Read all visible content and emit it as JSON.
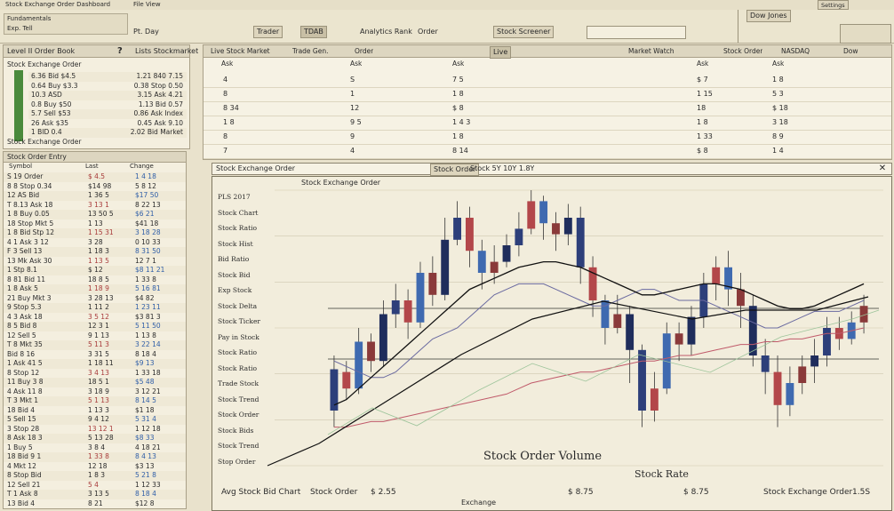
{
  "menubar": {
    "title_left": "Stock Exchange Order Dashboard",
    "title_mid": "File View",
    "btn_right": "Settings"
  },
  "toolbar": {
    "items": [
      "Fundamentals",
      "Exp. Tell",
      "Pt. Day",
      "Trader",
      "TDAB",
      "Analytics Rank",
      "Order",
      "Stock Screener"
    ],
    "right_label": "Dow Jones"
  },
  "left_top": {
    "title": "Level II Order Book",
    "question": "?",
    "tab": "Lists Stockmarket",
    "sub": "Stock Exchange Order",
    "rows": [
      {
        "a": "6.36 Bid $4.5",
        "b": "1.21 840 7.15"
      },
      {
        "a": "0.64 Buy $3.3",
        "b": "0.38 Stop 0.50"
      },
      {
        "a": "10.3 ASD",
        "b": "3.15 Ask 4.21"
      },
      {
        "a": "0.8 Buy $50",
        "b": "1.13 Bid 0.57"
      },
      {
        "a": "5.7 Sell $53",
        "b": "0.86 Ask Index"
      },
      {
        "a": "26 Ask $35",
        "b": "0.45 Ask 9.10"
      },
      {
        "a": "1 BID 0.4",
        "b": "2.02 Bid Market"
      }
    ],
    "footer": "Stock Exchange Order"
  },
  "watchlist": {
    "title": "Stock Order Entry",
    "columns": [
      "Symbol",
      "Last",
      "Change"
    ],
    "rows": [
      [
        "S 19 Order",
        "$ 4.5",
        "1 4 18"
      ],
      [
        "8 8 Stop 0.34",
        "$14 98",
        "5 8 12"
      ],
      [
        "12 AS Bid",
        "1 36 5",
        "$17 50"
      ],
      [
        "T 8.13 Ask 18",
        "3 13 1",
        "8 22 13"
      ],
      [
        "1 8 Buy 0.05",
        "13 50 5",
        "$6 21"
      ],
      [
        "18 Stop Mkt 5",
        "1 13",
        "$41 18"
      ],
      [
        "1 8 Bid Stp 12",
        "1 15 31",
        "3 18 28"
      ],
      [
        "4 1 Ask 3 12",
        "3 28",
        "0 10 33"
      ],
      [
        "F 3 Sell 13",
        "1 18 3",
        "8 31 50"
      ],
      [
        "13 Mk Ask 30",
        "1 13 5",
        "12 7 1"
      ],
      [
        "1 Stp 8.1",
        "$ 12",
        "$8 11 21"
      ],
      [
        "8 81 Bid 11",
        "18 8 5",
        "1 33 8"
      ],
      [
        "1 8 Ask 5",
        "1 18 9",
        "5 16 81"
      ],
      [
        "21 Buy Mkt 3",
        "3 28 13",
        "$4 82"
      ],
      [
        "9 Stop 5.3",
        "1 11 2",
        "1 23 11"
      ],
      [
        "4 3 Ask 18",
        "3 5 12",
        "$3 81 3"
      ],
      [
        "8 5 Bid 8",
        "12 3 1",
        "5 11 50"
      ],
      [
        "12 Sell 5",
        "9 1 13",
        "1 13 8"
      ],
      [
        "T 8 Mkt 35",
        "5 11 3",
        "3 22 14"
      ],
      [
        "Bid 8 16",
        "3 31 5",
        "8 18 4"
      ],
      [
        "1 Ask 41 5",
        "1 18 11",
        "$9 13"
      ],
      [
        "8 Stop 12",
        "3 4 13",
        "1 33 18"
      ],
      [
        "11 Buy 3 8",
        "18 5 1",
        "$5 48"
      ],
      [
        "4 Ask 11 8",
        "3 18 9",
        "3 12 21"
      ],
      [
        "T 3 Mkt 1",
        "5 1 13",
        "8 14 5"
      ],
      [
        "18 Bid 4",
        "1 13 3",
        "$1 18"
      ],
      [
        "5 Sell 15",
        "9 4 12",
        "5 31 4"
      ],
      [
        "3 Stop 28",
        "13 12 1",
        "1 12 18"
      ],
      [
        "8 Ask 18 3",
        "5 13 28",
        "$8 33"
      ],
      [
        "1 Buy 5",
        "3 8 4",
        "4 18 21"
      ],
      [
        "18 Bid 9 1",
        "1 33 8",
        "8 4 13"
      ],
      [
        "4 Mkt 12",
        "12 18",
        "$3 13"
      ],
      [
        "8 Stop Bid",
        "1 8 3",
        "5 21 8"
      ],
      [
        "12 Sell 21",
        "5 4",
        "1 12 33"
      ],
      [
        "T 1 Ask 8",
        "3 13 5",
        "8 18 4"
      ],
      [
        "13 Bid 4",
        "8 21",
        "$12 8"
      ]
    ]
  },
  "order_grid": {
    "tabs": [
      "Live Stock Market",
      "Trade Gen.",
      "Order"
    ],
    "chip": "Live",
    "right": [
      "Market Watch",
      "Stock Order",
      "NASDAQ",
      "Dow"
    ],
    "columns": [
      "Ask",
      "Ask",
      "Ask",
      "Ask",
      "Ask"
    ],
    "rows": [
      [
        "4",
        "S",
        "7 5",
        "$ 7",
        "1 8"
      ],
      [
        "8",
        "1",
        "1 8",
        "1 15",
        "5 3"
      ],
      [
        "8 34",
        "12",
        "$ 8",
        "18",
        "$ 18"
      ],
      [
        "1 8",
        "9 5",
        "1 4 3",
        "1 8",
        "3 18"
      ],
      [
        "8",
        "9",
        "1 8",
        "1 33",
        "8 9"
      ],
      [
        "7",
        "4",
        "8 14",
        "$ 8",
        "1 4"
      ]
    ]
  },
  "chart_bar": {
    "label_left": "Stock Exchange Order",
    "label_mid": "Stock Order",
    "label_chip": "Stock 5Y 10Y 1.8Y",
    "close_icon": "close-icon"
  },
  "chart": {
    "overlay_title": "Stock Exchange Order",
    "left_labels": [
      "PLS 2017",
      "Stock Chart",
      "Stock Ratio",
      "Stock Hist",
      "Bid Ratio",
      "Stock Bid",
      "Exp Stock",
      "Stock Delta",
      "Stock Ticker",
      "Pay in Stock",
      "Stock Ratio",
      "Stock Ratio",
      "Trade Stock",
      "Stock Trend",
      "Stock Order",
      "Stock Bids",
      "Stock Trend",
      "Stop Order"
    ],
    "annotation_main": "Stock Order Volume",
    "annotation_right": "Stock Rate",
    "bottom_labels": [
      "Avg Stock Bid Chart",
      "Stock Order",
      "$ 2.55",
      "Exchange",
      "$ 8.75",
      "$ 8.75",
      "Stock Exchange Order",
      "1.5S"
    ],
    "status_bottom": "Exchange"
  },
  "chart_data": {
    "type": "candlestick",
    "note": "Visual candlestick chart with moving averages; values approximate in price units",
    "y_range": [
      0,
      100
    ],
    "candles": [
      [
        20,
        35,
        14,
        40
      ],
      [
        34,
        28,
        24,
        38
      ],
      [
        28,
        45,
        26,
        50
      ],
      [
        45,
        38,
        34,
        48
      ],
      [
        38,
        55,
        36,
        60
      ],
      [
        55,
        60,
        50,
        66
      ],
      [
        60,
        52,
        46,
        64
      ],
      [
        52,
        70,
        50,
        74
      ],
      [
        70,
        62,
        58,
        76
      ],
      [
        62,
        82,
        60,
        90
      ],
      [
        82,
        90,
        80,
        96
      ],
      [
        90,
        78,
        72,
        94
      ],
      [
        78,
        70,
        64,
        82
      ],
      [
        70,
        74,
        66,
        80
      ],
      [
        74,
        80,
        72,
        84
      ],
      [
        80,
        86,
        76,
        92
      ],
      [
        86,
        96,
        84,
        100
      ],
      [
        96,
        88,
        82,
        98
      ],
      [
        88,
        84,
        78,
        92
      ],
      [
        84,
        90,
        80,
        95
      ],
      [
        90,
        72,
        66,
        94
      ],
      [
        72,
        60,
        54,
        76
      ],
      [
        60,
        50,
        44,
        62
      ],
      [
        50,
        55,
        48,
        62
      ],
      [
        55,
        42,
        30,
        58
      ],
      [
        42,
        20,
        14,
        44
      ],
      [
        20,
        28,
        16,
        34
      ],
      [
        28,
        48,
        26,
        52
      ],
      [
        48,
        44,
        38,
        52
      ],
      [
        44,
        54,
        40,
        58
      ],
      [
        54,
        66,
        50,
        70
      ],
      [
        66,
        72,
        60,
        76
      ],
      [
        72,
        64,
        58,
        78
      ],
      [
        64,
        58,
        50,
        70
      ],
      [
        58,
        40,
        36,
        62
      ],
      [
        40,
        34,
        26,
        46
      ],
      [
        34,
        22,
        14,
        40
      ],
      [
        22,
        30,
        18,
        36
      ],
      [
        30,
        36,
        26,
        40
      ],
      [
        36,
        40,
        30,
        46
      ],
      [
        40,
        50,
        36,
        54
      ],
      [
        50,
        46,
        42,
        54
      ],
      [
        46,
        52,
        44,
        56
      ],
      [
        52,
        58,
        48,
        62
      ]
    ],
    "moving_average_1": [
      22,
      24,
      28,
      32,
      36,
      40,
      44,
      48,
      52,
      56,
      60,
      64,
      66,
      68,
      70,
      72,
      73,
      74,
      74,
      73,
      72,
      70,
      68,
      66,
      64,
      62,
      62,
      63,
      64,
      65,
      66,
      66,
      65,
      64,
      62,
      60,
      58,
      57,
      57,
      58,
      60,
      62,
      64,
      66
    ],
    "moving_average_2": [
      38,
      36,
      34,
      32,
      32,
      34,
      38,
      42,
      46,
      48,
      50,
      54,
      58,
      62,
      64,
      66,
      66,
      66,
      64,
      62,
      60,
      58,
      58,
      60,
      62,
      64,
      64,
      62,
      60,
      60,
      60,
      58,
      56,
      54,
      52,
      50,
      50,
      52,
      54,
      56,
      56,
      56,
      58,
      60
    ],
    "moving_average_3": [
      14,
      14,
      15,
      16,
      16,
      17,
      18,
      19,
      20,
      21,
      22,
      23,
      24,
      25,
      26,
      28,
      30,
      31,
      32,
      33,
      34,
      34,
      35,
      36,
      37,
      38,
      38,
      39,
      40,
      40,
      41,
      42,
      43,
      44,
      44,
      45,
      45,
      46,
      46,
      47,
      48,
      48,
      49,
      50
    ]
  }
}
